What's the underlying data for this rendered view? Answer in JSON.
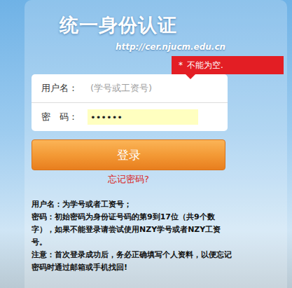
{
  "header": {
    "title": "统一身份认证",
    "url": "http://cer.njucm.edu.cn"
  },
  "tooltip": {
    "mark": "*",
    "text": "不能为空."
  },
  "fields": [
    {
      "label": "用户名：",
      "placeholder": "(学号或工资号)",
      "value": "",
      "kind": "text",
      "highlighted": false
    },
    {
      "label": "密　码：",
      "placeholder": "",
      "value": "••••••",
      "kind": "password",
      "highlighted": true
    }
  ],
  "login_button": "登录",
  "forgot_link": "忘记密码?",
  "notes": [
    {
      "segments": [
        {
          "text": "用户名",
          "bold": true
        },
        {
          "text": "：为学号或者工资号；",
          "bold": false
        }
      ]
    },
    {
      "segments": [
        {
          "text": "密码",
          "bold": true
        },
        {
          "text": "：初始密码为身份证号码的第9到17位（共9个数字），如果不能登录请尝试使用",
          "bold": false
        },
        {
          "text": "NZY学号",
          "bold": true
        },
        {
          "text": "或者",
          "bold": false
        },
        {
          "text": "NZY工资号",
          "bold": true
        },
        {
          "text": "。",
          "bold": false
        }
      ]
    },
    {
      "segments": [
        {
          "text": "注意",
          "bold": true
        },
        {
          "text": "：首次登录成功后，务必正确填写个人资料，以便忘记密码时通过邮箱或手机找回!",
          "bold": false
        }
      ]
    }
  ]
}
